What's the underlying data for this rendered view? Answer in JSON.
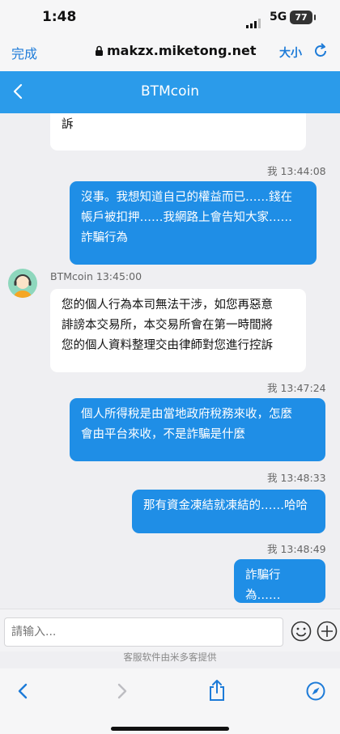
{
  "status": {
    "time": "1:48",
    "network": "5G",
    "battery": "77"
  },
  "browser": {
    "done_label": "完成",
    "url": "makzx.miketong.net",
    "text_size_label": "大小"
  },
  "header": {
    "title": "BTMcoin"
  },
  "messages": [
    {
      "side": "in",
      "text": "訴"
    },
    {
      "side": "out",
      "stamp": "我 13:44:08",
      "lines": [
        "沒事。我想知道自己的權益而已……錢在",
        "帳戶被扣押……我網路上會告知大家……",
        "詐騙行為"
      ]
    },
    {
      "side": "in",
      "stamp": "BTMcoin 13:45:00",
      "lines": [
        "您的個人行為本司無法干涉，如您再惡意",
        "誹謗本交易所，本交易所會在第一時間將",
        "您的個人資料整理交由律師對您進行控訴"
      ]
    },
    {
      "side": "out",
      "stamp": "我 13:47:24",
      "lines": [
        "個人所得稅是由當地政府稅務來收，怎麼",
        "會由平台來收，不是詐騙是什麼"
      ]
    },
    {
      "side": "out",
      "stamp": "我 13:48:33",
      "lines": [
        "那有資金凍結就凍結的……哈哈"
      ]
    },
    {
      "side": "out",
      "stamp": "我 13:48:49",
      "lines": [
        "詐騙行為……"
      ]
    }
  ],
  "input": {
    "placeholder": "請输入..."
  },
  "footer": {
    "provider": "客服软件由米多客提供"
  },
  "icons": [
    "lock-icon",
    "refresh-icon",
    "back-icon",
    "emoji-icon",
    "plus-icon",
    "nav-back-icon",
    "nav-forward-icon",
    "share-icon",
    "compass-icon"
  ],
  "colors": {
    "accent": "#2b9bea",
    "outgoing_bubble": "#1f8ee6",
    "incoming_bubble": "#ffffff"
  }
}
